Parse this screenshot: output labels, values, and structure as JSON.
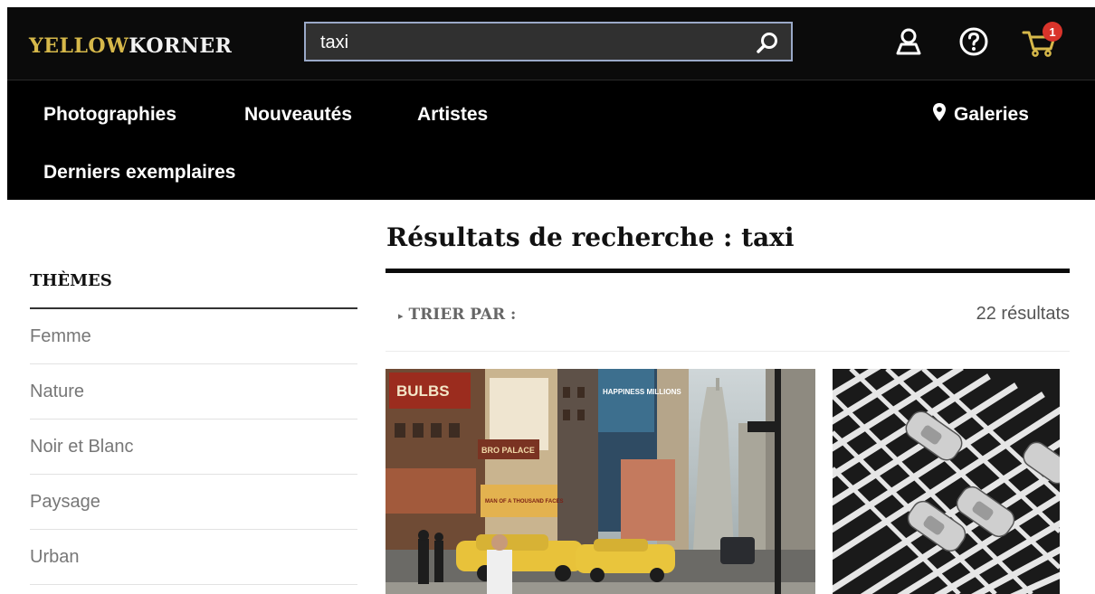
{
  "header": {
    "logo_part1": "YELLOW",
    "logo_part2": "KORNER",
    "search_value": "taxi",
    "cart_count": "1",
    "icons": [
      "search-icon",
      "user-icon",
      "help-icon",
      "cart-icon"
    ]
  },
  "nav": {
    "items": [
      "Photographies",
      "Nouveautés",
      "Artistes",
      "Derniers exemplaires"
    ],
    "galleries": "Galeries"
  },
  "sidebar": {
    "title": "THÈMES",
    "items": [
      "Femme",
      "Nature",
      "Noir et Blanc",
      "Paysage",
      "Urban"
    ]
  },
  "results": {
    "title": "Résultats de recherche : taxi",
    "sort_label": "TRIER PAR :",
    "count": "22 résultats"
  },
  "photos": {
    "street_signs": [
      "BULBS",
      "HAPPINESS MILLIONS",
      "MAN OF A THOUSAND FACES",
      "BRO PALACE"
    ]
  },
  "colors": {
    "brand_yellow": "#d6b84a",
    "header_bg": "#0b0b0b",
    "badge_red": "#d9342b",
    "search_border": "#9aa9c8"
  }
}
